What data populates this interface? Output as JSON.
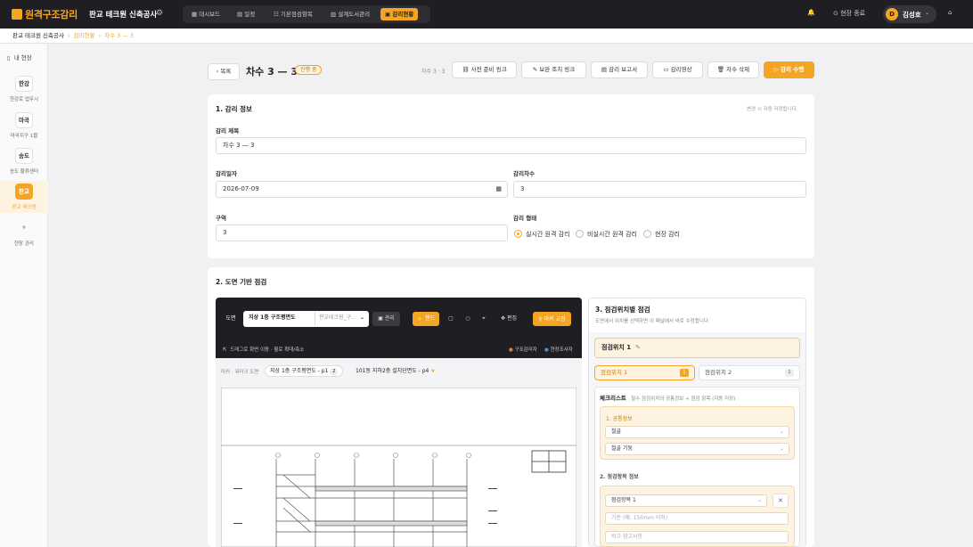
{
  "app": {
    "logo": "원격구조감리",
    "project": "판교 테크원 신축공사"
  },
  "nav": [
    "대시보드",
    "일정",
    "기본점검항목",
    "설계도서관리",
    "감리현황"
  ],
  "topright": {
    "end_label": "현장 종료",
    "user_initial": "D",
    "user_name": "김성호"
  },
  "breadcrumb": [
    "판교 테크원 신축공사",
    "감리현황",
    "차수 3 — 3"
  ],
  "sidebar": {
    "header": "내 현장",
    "items": [
      {
        "badge": "한강",
        "label": "한강로 업무시"
      },
      {
        "badge": "마곡",
        "label": "마곡지구 1블"
      },
      {
        "badge": "송도",
        "label": "송도 물류센터"
      },
      {
        "badge": "판교",
        "label": "판교 테크원"
      },
      {
        "badge": "+",
        "label": "현장 관리"
      }
    ]
  },
  "header": {
    "back": "목록",
    "title": "차수 3 — 3",
    "status": "진행 중",
    "round_info": "차수 3 · 3",
    "buttons": [
      "사전 준비 링크",
      "보완 조치 링크",
      "감리 보고서",
      "감리영상",
      "차수 삭제"
    ],
    "primary": "감리 수행"
  },
  "info": {
    "section": "1. 감리 정보",
    "autosave": "변경 시 자동 저장됩니다.",
    "title_label": "감리 제목",
    "title_value": "차수 3 — 3",
    "date_label": "감리일자",
    "date_value": "2026-07-09",
    "round_label": "감리차수",
    "round_value": "3",
    "zone_label": "구역",
    "zone_value": "3",
    "type_label": "감리 형태",
    "types": [
      "실시간 원격 감리",
      "비실시간 원격 감리",
      "현장 감리"
    ]
  },
  "drawing": {
    "section": "2. 도면 기반 점검",
    "tab_label": "도면",
    "drawing_name": "지상 1층 구조평면도",
    "drawing_sub": "판교테크원_구...",
    "manage": "관리",
    "hand": "핸드",
    "edit": "편집",
    "marker": "마커 교정",
    "hint": "드래그로 화면 이동 · 휠로 확대/축소",
    "legend": [
      "구조감리자",
      "현장조사자"
    ],
    "marker_label": "마커 · 워마크 도면",
    "chips": [
      {
        "name": "지상 1층 구조평면도 - p1",
        "count": "2"
      },
      {
        "name": "101동 지하2층 설치단면도 - p4",
        "count": "★"
      }
    ]
  },
  "inspect": {
    "section": "3. 점검위치별 점검",
    "desc": "도면에서 위치를 선택하면 이 패널에서 바로 수정합니다.",
    "loc_title": "점검위치 1",
    "tabs": [
      {
        "name": "점검위치 1",
        "count": "1"
      },
      {
        "name": "점검위치 2",
        "count": "1"
      }
    ],
    "checklist_label": "체크리스트",
    "checklist_desc": "필수 점검위치의 공통정보 + 점검 항목 (자동 저장)",
    "common_label": "1. 공통정보",
    "common_vals": [
      "철골",
      "철골 기둥"
    ],
    "items_label": "2. 점검항목 정보",
    "item_value": "점검항목 1",
    "std_placeholder": "기준 (예: 150mm 이하)",
    "note_placeholder": "비고·참고사항"
  }
}
